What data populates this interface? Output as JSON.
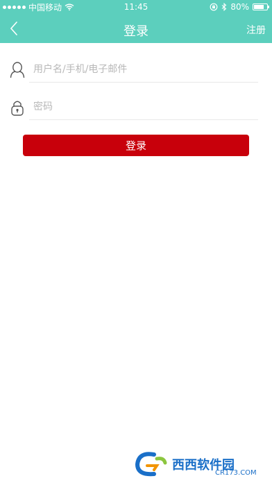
{
  "status_bar": {
    "carrier": "中国移动",
    "time": "11:45",
    "battery": "80%",
    "battery_level": 0.8
  },
  "nav": {
    "title": "登录",
    "register_label": "注册"
  },
  "form": {
    "username_placeholder": "用户名/手机/电子邮件",
    "username_value": "",
    "password_placeholder": "密码",
    "password_value": "",
    "submit_label": "登录"
  },
  "watermark": {
    "text": "西西软件园",
    "sub": "CR173.COM"
  },
  "colors": {
    "header": "#5ccfbd",
    "primary_button": "#c8000b"
  }
}
